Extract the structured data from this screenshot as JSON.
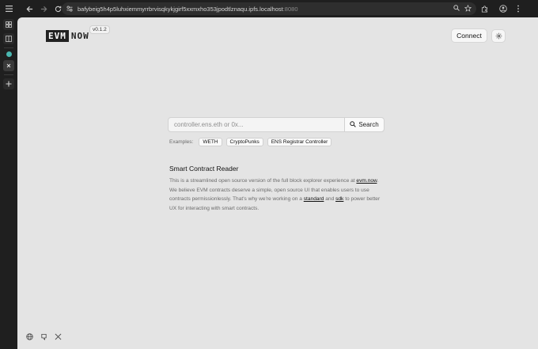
{
  "browser": {
    "url_main": "bafybeig5h4p5luhxiemmyrrbrvisqkykjgirf5xxmxho353jpodtlznaqu.ipfs.localhost",
    "url_port": ":8080"
  },
  "header": {
    "logo_box": "EVM",
    "logo_text": "NOW",
    "version": "v0.1.2",
    "connect_label": "Connect"
  },
  "search": {
    "placeholder": "controller.ens.eth or 0x...",
    "button_label": "Search"
  },
  "examples": {
    "label": "Examples:",
    "items": [
      "WETH",
      "CryptoPunks",
      "ENS Registrar Controller"
    ]
  },
  "about": {
    "title": "Smart Contract Reader",
    "p1": "This is a streamlined open source version of the full block explorer experience at ",
    "link1": "evm.now",
    "p2": ". We believe EVM contracts deserve a simple, open source UI that enables users to use contracts permissionlessly. That's why we're working on a ",
    "link2": "standard",
    "p3": " and ",
    "link3": "sdk",
    "p4": " to power better UX for interacting with smart contracts."
  },
  "icons": {
    "footer": [
      "globe-icon",
      "github-icon",
      "x-icon"
    ]
  }
}
